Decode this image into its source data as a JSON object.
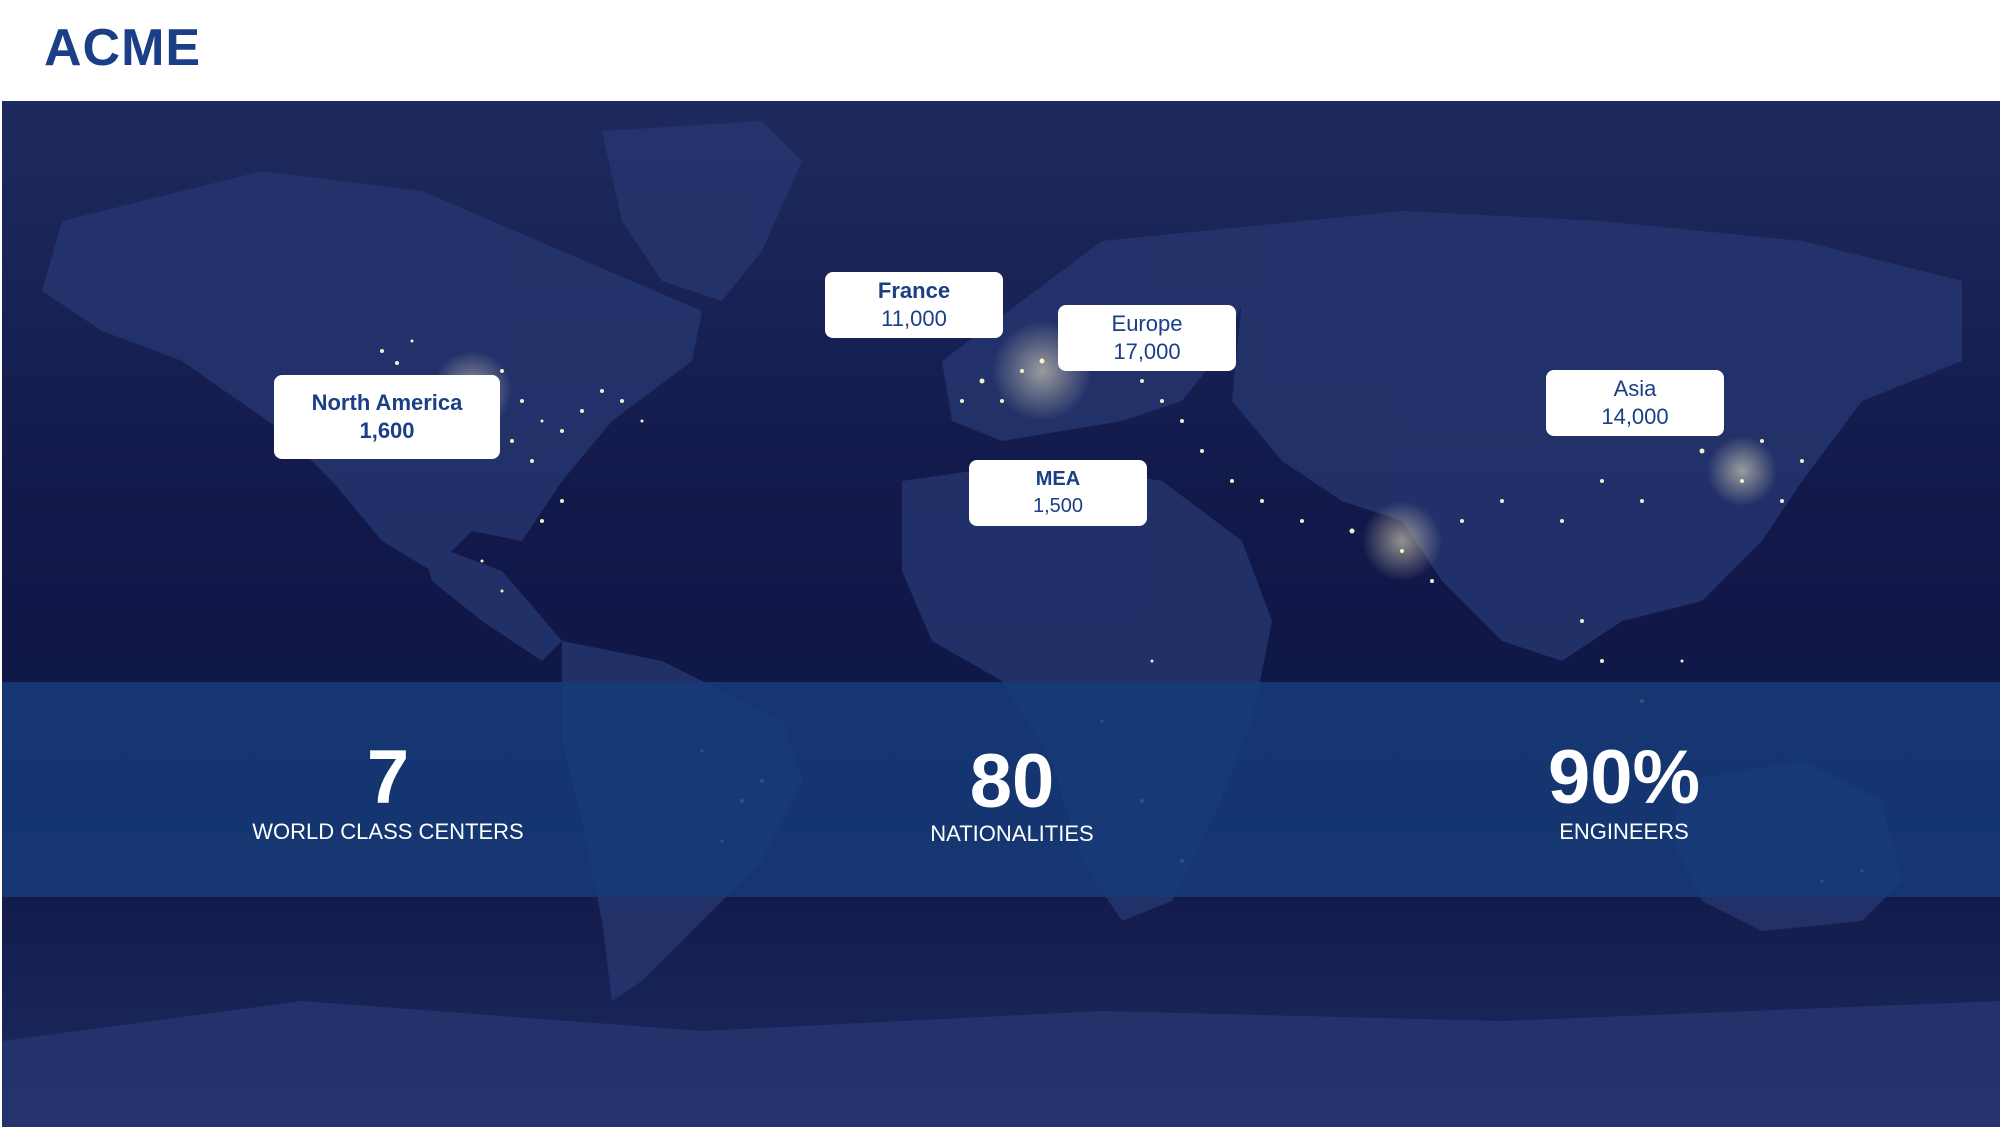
{
  "logo": "ACME",
  "regions": [
    {
      "id": "north-america",
      "name": "North America",
      "value": "1,600"
    },
    {
      "id": "france",
      "name": "France",
      "value": "11,000"
    },
    {
      "id": "europe",
      "name": "Europe",
      "value": "17,000"
    },
    {
      "id": "mea",
      "name": "MEA",
      "value": "1,500"
    },
    {
      "id": "asia",
      "name": "Asia",
      "value": "14,000"
    }
  ],
  "stats": [
    {
      "value": "7",
      "label": "WORLD CLASS CENTERS"
    },
    {
      "value": "80",
      "label": "NATIONALITIES"
    },
    {
      "value": "90%",
      "label": "ENGINEERS"
    }
  ],
  "colors": {
    "brand": "#1b3f86",
    "map_background": "#12194a",
    "band": "#163a76",
    "city_lights": "#f3f0c8"
  }
}
